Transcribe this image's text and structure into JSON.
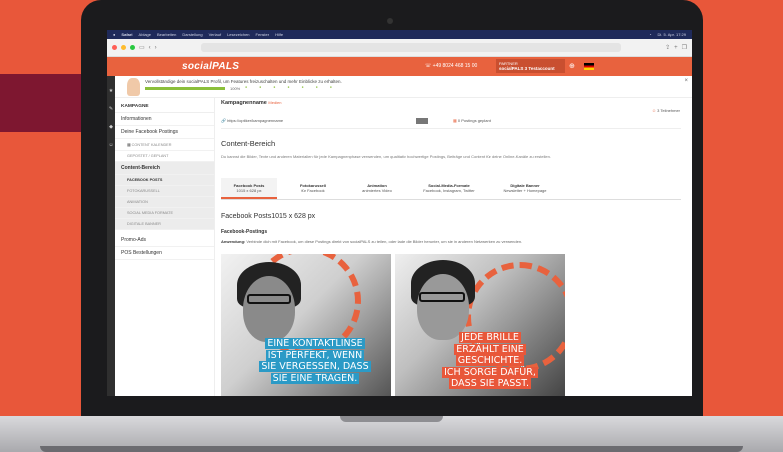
{
  "menubar": {
    "items": [
      "Safari",
      "Ablage",
      "Bearbeiten",
      "Darstellung",
      "Verlauf",
      "Lesezeichen",
      "Fenster",
      "Hilfe"
    ],
    "status": "Di. 5. Apr. 17:29"
  },
  "browser": {
    "url": ""
  },
  "header": {
    "logo": "socialPALS",
    "phone": "+49 8024 468 15 00",
    "account_line1": "PARTNER",
    "account_line2": "socialPALS 3 Testaccount"
  },
  "progress": {
    "message": "Vervollständige dein socialPALS Profil, um Features freizuschalten und mehr Einblicke zu erhalten.",
    "percent": 100,
    "percent_label": "100%"
  },
  "sidebar": {
    "heading": "KAMPAGNE",
    "items": [
      "Informationen",
      "Deine Facebook Postings"
    ],
    "calendar": "CONTENT KALENDER",
    "planned": "GEPOSTET / GEPLANT",
    "content": "Content-Bereich",
    "content_items": [
      "FACEBOOK POSTS",
      "FOTOKARUSSELL",
      "ANIMATION",
      "SOCIAL MEDIA FORMATE",
      "DIGITALE BANNER"
    ],
    "bottom": [
      "Promo-Ads",
      "POS Bestellungen"
    ]
  },
  "campaign": {
    "name": "Kampagnenname",
    "name_tag": "Medien",
    "link": "https://optiker/kampagnenname",
    "posts": "0 Postings geplant",
    "teilnehmer": "3 Teilnehmer"
  },
  "content": {
    "title": "Content-Bereich",
    "description": "Du kannst die Bilder, Texte und anderen Materialien für jede Kampagnenphase verwenden, um qualitativ hochwertige Postings, Beiträge und Content für deine Online-Kanäle zu erstellen.",
    "tabs": [
      {
        "title": "Facebook Posts",
        "sub": "1015 x 628 px"
      },
      {
        "title": "Fotokarussell",
        "sub": "für Facebook"
      },
      {
        "title": "Animation",
        "sub": "animiertes Video"
      },
      {
        "title": "Social-Media-Formate",
        "sub": "Facebook, Instagram, Twitter"
      },
      {
        "title": "Digitale Banner",
        "sub": "Newsletter + Homepage"
      }
    ],
    "fb_heading": "Facebook Posts1015 x 628 px",
    "fb_sub": "Facebook-Postings",
    "usage_label": "Anwendung:",
    "usage_text": " Verbinde dich mit Facebook, um diese Postings direkt von socialPALS zu teilen, oder lade die Bilder herunter, um sie in anderen Netzwerken zu verwenden.",
    "image1_lines": [
      "EINE KONTAKTLINSE",
      "IST PERFEKT, WENN",
      "SIE VERGESSEN, DASS",
      "SIE EINE TRAGEN."
    ],
    "image2_lines": [
      "JEDE BRILLE",
      "ERZÄHLT EINE",
      "GESCHICHTE.",
      "ICH SORGE DAFÜR,",
      "DASS SIE PASST."
    ]
  },
  "colors": {
    "brand": "#e8623e",
    "background": "#e8573a",
    "accent_stripe": "#7e1730",
    "progress": "#8bbf3b",
    "caption_blue": "#2b9ac6"
  }
}
